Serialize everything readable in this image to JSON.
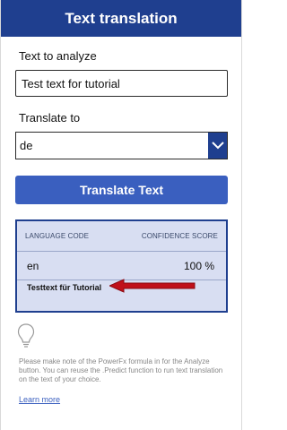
{
  "header": {
    "title": "Text translation"
  },
  "form": {
    "text_label": "Text to analyze",
    "text_value": "Test text for tutorial",
    "translate_label": "Translate to",
    "language_value": "de",
    "translate_button": "Translate Text"
  },
  "results": {
    "col_language": "LANGUAGE CODE",
    "col_confidence": "CONFIDENCE SCORE",
    "language_code": "en",
    "confidence": "100 %",
    "translated_text": "Testtext für Tutorial"
  },
  "info": {
    "note": "Please make note of the PowerFx formula in for the Analyze button. You can reuse the .Predict function to run text translation on the text of your choice.",
    "link": "Learn more"
  },
  "colors": {
    "header_bg": "#1f3f8f",
    "button_bg": "#3a5fbf",
    "results_bg": "#d8def2",
    "annotation_arrow": "#c0101a"
  },
  "icons": [
    "chevron-down-icon",
    "annotation-arrow-icon",
    "lightbulb-icon"
  ]
}
